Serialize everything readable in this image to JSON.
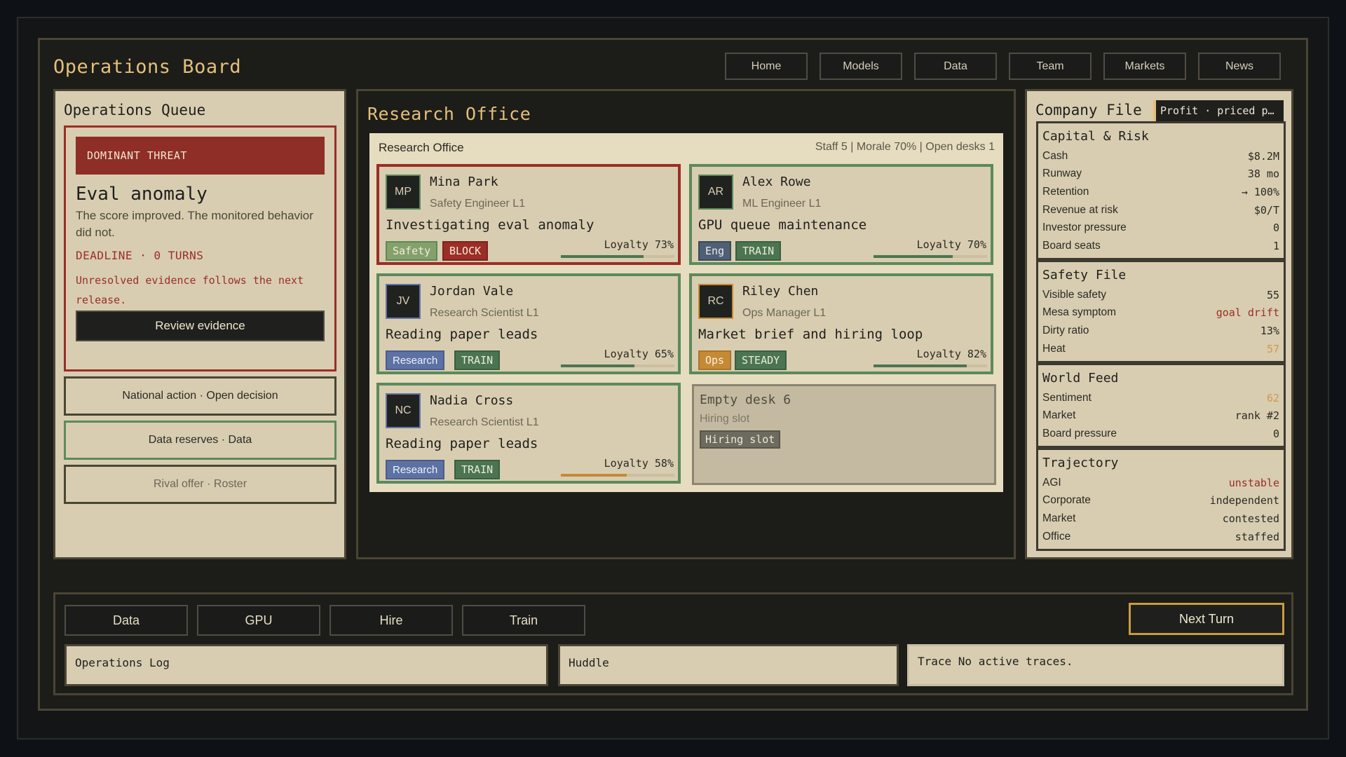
{
  "header": {
    "title": "Operations Board",
    "nav": [
      "Home",
      "Models",
      "Data",
      "Team",
      "Markets",
      "News"
    ]
  },
  "ops_queue": {
    "title": "Operations Queue",
    "threat": {
      "banner": "DOMINANT THREAT",
      "title": "Eval anomaly",
      "description": "The score improved. The monitored behavior did not.",
      "deadline": "DEADLINE · 0 TURNS",
      "note": "Unresolved evidence follows the next release.",
      "action": "Review evidence"
    },
    "items": [
      "National action · Open decision",
      "Data reserves · Data",
      "Rival offer · Roster"
    ]
  },
  "research": {
    "title": "Research Office",
    "office_label": "Research Office",
    "stats": "Staff 5 | Morale 70% | Open desks 1",
    "staff": [
      {
        "initials": "MP",
        "name": "Mina Park",
        "role": "Safety Engineer L1",
        "task": "Investigating eval anomaly",
        "tags": [
          "Safety",
          "BLOCK"
        ],
        "loyalty": "Loyalty 73%",
        "loyalty_value": 0.73
      },
      {
        "initials": "AR",
        "name": "Alex Rowe",
        "role": "ML Engineer L1",
        "task": "GPU queue maintenance",
        "tags": [
          "Eng",
          "TRAIN"
        ],
        "loyalty": "Loyalty 70%",
        "loyalty_value": 0.7
      },
      {
        "initials": "JV",
        "name": "Jordan Vale",
        "role": "Research Scientist L1",
        "task": "Reading paper leads",
        "tags": [
          "Research",
          "TRAIN"
        ],
        "loyalty": "Loyalty 65%",
        "loyalty_value": 0.65
      },
      {
        "initials": "RC",
        "name": "Riley Chen",
        "role": "Ops Manager L1",
        "task": "Market brief and hiring loop",
        "tags": [
          "Ops",
          "STEADY"
        ],
        "loyalty": "Loyalty 82%",
        "loyalty_value": 0.82
      },
      {
        "initials": "NC",
        "name": "Nadia Cross",
        "role": "Research Scientist L1",
        "task": "Reading paper leads",
        "tags": [
          "Research",
          "TRAIN"
        ],
        "loyalty": "Loyalty 58%",
        "loyalty_value": 0.58
      }
    ],
    "empty_desk": {
      "title": "Empty desk 6",
      "subtitle": "Hiring slot",
      "tag": "Hiring slot"
    }
  },
  "company": {
    "title": "Company File",
    "pill": "Profit · priced p…",
    "capital": {
      "title": "Capital & Risk",
      "rows": [
        [
          "Cash",
          "$8.2M"
        ],
        [
          "Runway",
          "38 mo"
        ],
        [
          "Retention",
          "→ 100%"
        ],
        [
          "Revenue at risk",
          "$0/T"
        ],
        [
          "Investor pressure",
          "0"
        ],
        [
          "Board seats",
          "1"
        ]
      ]
    },
    "safety": {
      "title": "Safety File",
      "rows": [
        [
          "Visible safety",
          "55"
        ],
        [
          "Mesa symptom",
          "goal drift"
        ],
        [
          "Dirty ratio",
          "13%"
        ],
        [
          "Heat",
          "57"
        ]
      ]
    },
    "world": {
      "title": "World Feed",
      "rows": [
        [
          "Sentiment",
          "62"
        ],
        [
          "Market",
          "rank #2"
        ],
        [
          "Board pressure",
          "0"
        ]
      ]
    },
    "trajectory": {
      "title": "Trajectory",
      "rows": [
        [
          "AGI",
          "unstable"
        ],
        [
          "Corporate",
          "independent"
        ],
        [
          "Market",
          "contested"
        ],
        [
          "Office",
          "staffed"
        ]
      ]
    },
    "colors": {
      "alert": "#9b2e27",
      "amber": "#cc9a48"
    }
  },
  "bottom": {
    "actions": [
      "Data",
      "GPU",
      "Hire",
      "Train"
    ],
    "next_turn": "Next Turn",
    "ops_log": "Operations Log",
    "huddle": "Huddle",
    "trace": "Trace No active traces."
  }
}
